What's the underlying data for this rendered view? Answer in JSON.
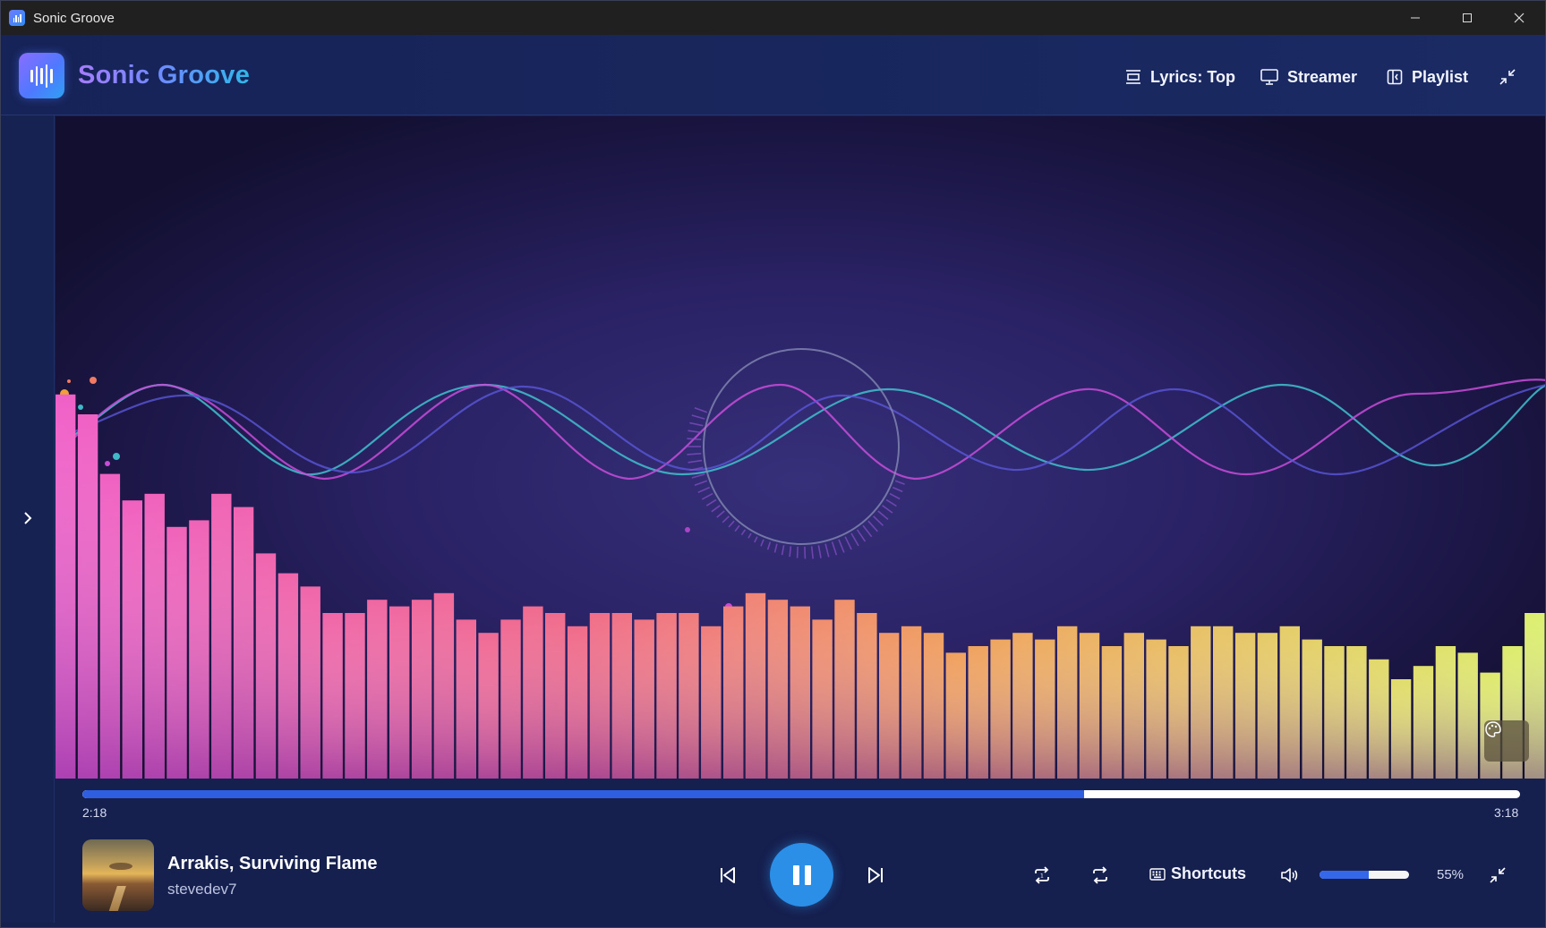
{
  "window": {
    "title": "Sonic Groove"
  },
  "header": {
    "brand": "Sonic Groove",
    "buttons": [
      {
        "label": "Lyrics: Top",
        "icon": "lyrics-position-icon"
      },
      {
        "label": "Streamer",
        "icon": "monitor-icon"
      },
      {
        "label": "Playlist",
        "icon": "sidebar-panel-icon"
      }
    ],
    "collapse_icon": "minimize-arrows-icon"
  },
  "sidebar": {
    "toggle_icon": "chevron-right-icon"
  },
  "visualizer": {
    "type": "bar",
    "bar_count": 67,
    "bar_levels": [
      0.58,
      0.55,
      0.46,
      0.42,
      0.43,
      0.38,
      0.39,
      0.43,
      0.41,
      0.34,
      0.31,
      0.29,
      0.25,
      0.25,
      0.27,
      0.26,
      0.27,
      0.28,
      0.24,
      0.22,
      0.24,
      0.26,
      0.25,
      0.23,
      0.25,
      0.25,
      0.24,
      0.25,
      0.25,
      0.23,
      0.26,
      0.28,
      0.27,
      0.26,
      0.24,
      0.27,
      0.25,
      0.22,
      0.23,
      0.22,
      0.19,
      0.2,
      0.21,
      0.22,
      0.21,
      0.23,
      0.22,
      0.2,
      0.22,
      0.21,
      0.2,
      0.23,
      0.23,
      0.22,
      0.22,
      0.23,
      0.21,
      0.2,
      0.2,
      0.18,
      0.15,
      0.17,
      0.2,
      0.19,
      0.16,
      0.2,
      0.25
    ],
    "palette_icon": "palette-icon"
  },
  "playback": {
    "elapsed": "2:18",
    "duration": "3:18",
    "progress": 0.697
  },
  "track": {
    "title": "Arrakis, Surviving Flame",
    "artist": "stevedev7"
  },
  "controls": {
    "shortcuts_label": "Shortcuts",
    "volume_percent": 55,
    "volume_label": "55%"
  },
  "colors": {
    "accent": "#2b8fe8",
    "progress_fill": "#2f5fe0",
    "bar_gradient_start": "#e34fc0",
    "bar_gradient_mid": "#f07a62",
    "bar_gradient_end": "#e3ee72"
  }
}
